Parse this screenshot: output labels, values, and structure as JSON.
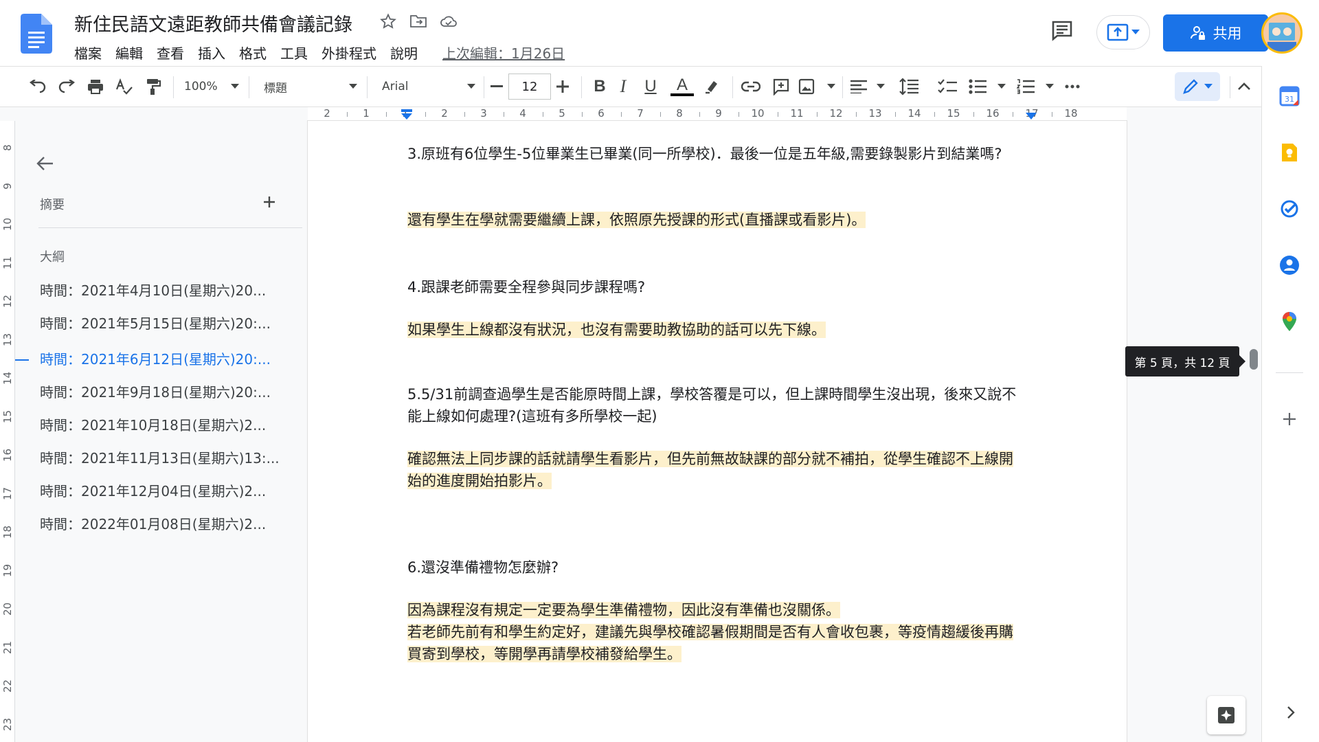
{
  "document": {
    "title": "新住民語文遠距教師共備會議記錄"
  },
  "menu": [
    {
      "id": "file",
      "label": "檔案"
    },
    {
      "id": "edit",
      "label": "編輯"
    },
    {
      "id": "view",
      "label": "查看"
    },
    {
      "id": "insert",
      "label": "插入"
    },
    {
      "id": "format",
      "label": "格式"
    },
    {
      "id": "tools",
      "label": "工具"
    },
    {
      "id": "addons",
      "label": "外掛程式"
    },
    {
      "id": "help",
      "label": "說明"
    }
  ],
  "last_edit": "上次編輯：1月26日",
  "share_label": "共用",
  "toolbar": {
    "zoom": "100%",
    "style": "標題",
    "font": "Arial",
    "font_size": "12"
  },
  "ruler": {
    "h_labels": [
      "2",
      "1",
      "1",
      "2",
      "3",
      "4",
      "5",
      "6",
      "7",
      "8",
      "9",
      "10",
      "11",
      "12",
      "13",
      "14",
      "15",
      "16",
      "17",
      "18"
    ],
    "v_labels": [
      "8",
      "9",
      "10",
      "11",
      "12",
      "13",
      "14",
      "15",
      "16",
      "17",
      "18",
      "19",
      "20",
      "21",
      "22",
      "23"
    ]
  },
  "outline": {
    "summary_label": "摘要",
    "outline_label": "大綱",
    "items": [
      {
        "text": "時間：2021年4月10日(星期六)20..."
      },
      {
        "text": "時間：2021年5月15日(星期六)20:..."
      },
      {
        "text": "時間：2021年6月12日(星期六)20:..."
      },
      {
        "text": "時間：2021年9月18日(星期六)20:..."
      },
      {
        "text": "時間：2021年10月18日(星期六)2..."
      },
      {
        "text": "時間：2021年11月13日(星期六)13:..."
      },
      {
        "text": "時間：2021年12月04日(星期六)2..."
      },
      {
        "text": "時間：2022年01月08日(星期六)2..."
      }
    ],
    "active_index": 2
  },
  "content": {
    "q3": "3.原班有6位學生-5位畢業生已畢業(同一所學校)．最後一位是五年級,需要錄製影片到結業嗎?",
    "a3": "還有學生在學就需要繼續上課，依照原先授課的形式(直播課或看影片)。",
    "q4": "4.跟課老師需要全程參與同步課程嗎?",
    "a4": "如果學生上線都沒有狀況，也沒有需要助教協助的話可以先下線。",
    "q5": "5.5/31前調查過學生是否能原時間上課，學校答覆是可以，但上課時間學生沒出現，後來又說不能上線如何處理?(這班有多所學校一起)",
    "a5": "確認無法上同步課的話就請學生看影片，但先前無故缺課的部分就不補拍，從學生確認不上線開始的進度開始拍影片。",
    "q6": "6.還沒準備禮物怎麼辦?",
    "a6_1": "因為課程沒有規定一定要為學生準備禮物，因此沒有準備也沒關係。",
    "a6_2": "若老師先前有和學生約定好，建議先與學校確認暑假期間是否有人會收包裹，等疫情趨緩後再購買寄到學校，等開學再請學校補發給學生。"
  },
  "page_indicator": "第 5 頁，共 12 頁",
  "colors": {
    "brand_blue": "#1a73e8",
    "highlight": "#fdf0cc",
    "docs_blue": "#4285f4"
  }
}
